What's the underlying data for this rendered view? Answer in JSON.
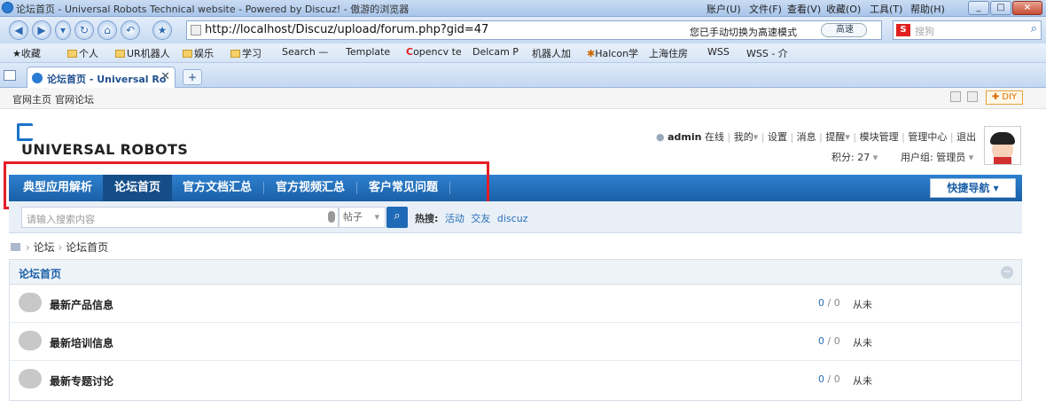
{
  "browser": {
    "title": "论坛首页 - Universal Robots Technical website - Powered by Discuz! - 傲游的浏览器",
    "menu": [
      "账户(U)",
      "文件(F)",
      "查看(V)",
      "收藏(O)",
      "工具(T)",
      "帮助(H)"
    ],
    "url": "http://localhost/Discuz/upload/forum.php?gid=47",
    "url_hint": "您已手动切换为高速模式",
    "speed_label": "高速",
    "search_placeholder": "搜狗",
    "bookmarks": [
      "收藏",
      "个人",
      "UR机器人",
      "娱乐",
      "学习",
      "Search —",
      "Template",
      "opencv te",
      "Delcam P",
      "机器人加",
      "Halcon学",
      "上海住房",
      "WSS",
      "WSS - 介"
    ],
    "tab_title": "论坛首页 - Universal Ro"
  },
  "site": {
    "top_links": [
      "官网主页",
      "官网论坛"
    ],
    "diy_label": "DIY",
    "logo_text": "UNIVERSAL ROBOTS",
    "user": {
      "name": "admin",
      "online": "在线",
      "links": [
        "我的",
        "设置",
        "消息",
        "提醒",
        "模块管理",
        "管理中心",
        "退出"
      ],
      "points": "积分: 27",
      "group": "用户组: 管理员"
    },
    "nav": [
      "典型应用解析",
      "论坛首页",
      "官方文档汇总",
      "官方视频汇总",
      "客户常见问题"
    ],
    "nav_active": 1,
    "quick_nav": "快捷导航",
    "search": {
      "placeholder": "请输入搜索内容",
      "type": "帖子",
      "hot_label": "热搜:",
      "hot": [
        "活动",
        "交友",
        "discuz"
      ]
    },
    "breadcrumb": [
      "论坛",
      "论坛首页"
    ],
    "board": {
      "title": "论坛首页",
      "forums": [
        {
          "name": "最新产品信息",
          "threads": "0",
          "posts": "0",
          "last": "从未"
        },
        {
          "name": "最新培训信息",
          "threads": "0",
          "posts": "0",
          "last": "从未"
        },
        {
          "name": "最新专题讨论",
          "threads": "0",
          "posts": "0",
          "last": "从未"
        }
      ]
    }
  },
  "colors": {
    "nav": "#1f6ab6",
    "highlight": "#e41e26",
    "link": "#2a6fb8"
  }
}
